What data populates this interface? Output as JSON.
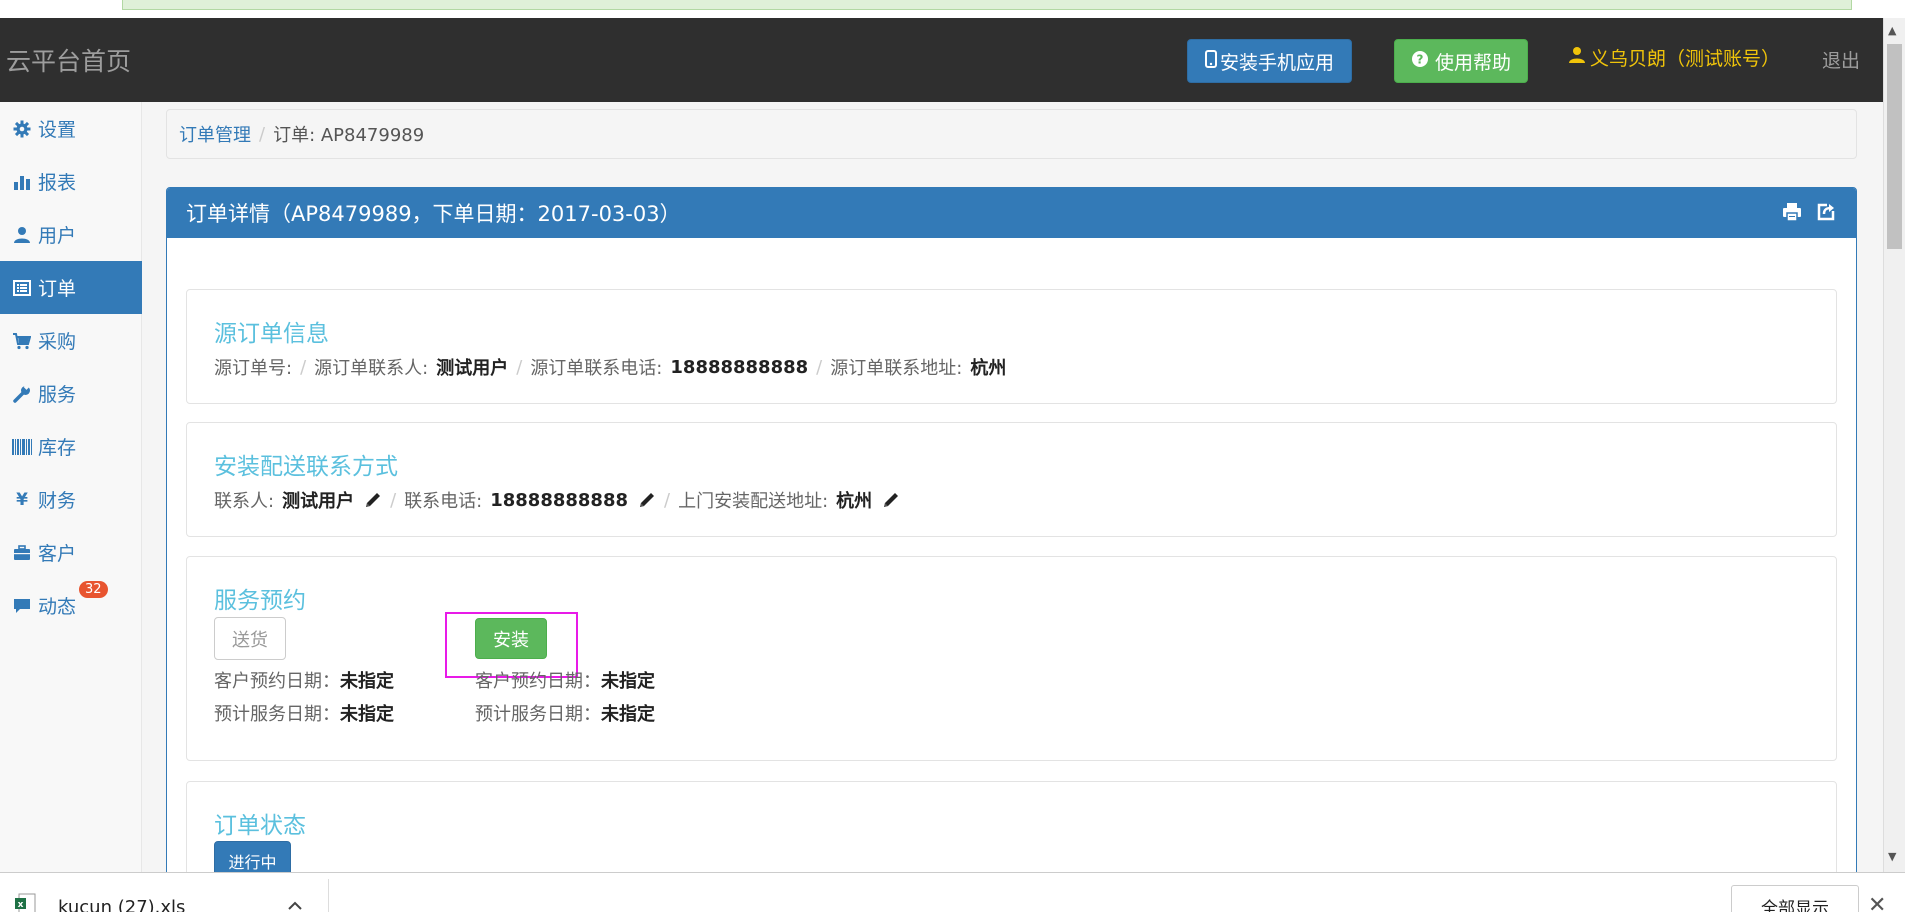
{
  "navbar": {
    "brand": "云平台首页",
    "install_app": "安装手机应用",
    "help": "使用帮助",
    "user": "义乌贝朗（测试账号）",
    "logout": "退出"
  },
  "sidebar": {
    "items": [
      {
        "label": "设置",
        "icon": "gear-icon"
      },
      {
        "label": "报表",
        "icon": "bar-chart-icon"
      },
      {
        "label": "用户",
        "icon": "user-icon"
      },
      {
        "label": "订单",
        "icon": "list-icon"
      },
      {
        "label": "采购",
        "icon": "cart-icon"
      },
      {
        "label": "服务",
        "icon": "wrench-icon"
      },
      {
        "label": "库存",
        "icon": "barcode-icon"
      },
      {
        "label": "财务",
        "icon": "yen-icon"
      },
      {
        "label": "客户",
        "icon": "briefcase-icon"
      },
      {
        "label": "动态",
        "icon": "comment-icon",
        "badge": "32"
      }
    ],
    "active_index": 3
  },
  "breadcrumb": {
    "root": "订单管理",
    "current": "订单: AP8479989"
  },
  "panel": {
    "title": "订单详情（AP8479989，下单日期：2017-03-03）"
  },
  "source_order": {
    "title": "源订单信息",
    "order_no_label": "源订单号:",
    "contact_label": "源订单联系人:",
    "contact_value": "测试用户",
    "phone_label": "源订单联系电话:",
    "phone_value": "18888888888",
    "address_label": "源订单联系地址:",
    "address_value": "杭州"
  },
  "install_contact": {
    "title": "安装配送联系方式",
    "contact_label": "联系人:",
    "contact_value": "测试用户",
    "phone_label": "联系电话:",
    "phone_value": "18888888888",
    "address_label": "上门安装配送地址:",
    "address_value": "杭州"
  },
  "service": {
    "title": "服务预约",
    "delivery_button": "送货",
    "install_button": "安装",
    "customer_date_label": "客户预约日期：",
    "customer_date_value": "未指定",
    "expected_date_label": "预计服务日期：",
    "expected_date_value": "未指定"
  },
  "order_status": {
    "title": "订单状态",
    "status": "进行中"
  },
  "downloads": {
    "file_name": "kucun (27).xls",
    "show_all": "全部显示"
  },
  "colors": {
    "primary": "#337ab7",
    "success": "#5cb85c",
    "info": "#5bc0de",
    "navbar": "#2f2f2f",
    "user_text": "#f0c40a",
    "highlight": "#e81ae8"
  }
}
